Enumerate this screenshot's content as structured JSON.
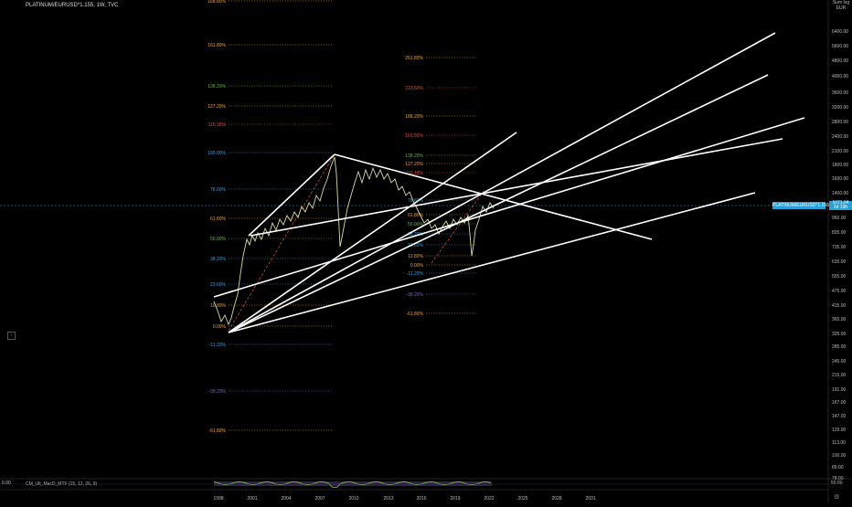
{
  "header": {
    "symbol_title": "PLATINUM/EURUSD*1.155, 1W, TVC",
    "axis_unit_top": "Sum lng",
    "axis_unit_bottom": "EUR"
  },
  "colors": {
    "background": "#000000",
    "price": "#d9d9a0",
    "channel": "#ffffff",
    "fib_orange": "#f0a030",
    "fib_green": "#6ab04c",
    "fib_red": "#e05040",
    "fib_blue": "#3aa0e0",
    "fib_purple": "#8060c0",
    "fib_gray": "#8a8a8a",
    "accent": "#2a9fd6"
  },
  "price_axis": {
    "labels": [
      "6400.00",
      "5600.00",
      "4800.00",
      "4000.00",
      "3600.00",
      "3200.00",
      "2800.00",
      "2400.00",
      "2100.00",
      "1800.00",
      "1600.00",
      "1400.00",
      "1240.00",
      "960.00",
      "835.00",
      "735.00",
      "635.00",
      "555.00",
      "475.00",
      "415.00",
      "365.00",
      "325.00",
      "285.00",
      "245.00",
      "215.00",
      "191.00",
      "167.00",
      "147.00",
      "129.00",
      "113.00",
      "100.00",
      "89.00",
      "78.00"
    ],
    "current_symbol": "PLATINUM/EURUSD*1.155",
    "current_price": "1071.04",
    "current_time": "2d 19h"
  },
  "time_axis": {
    "labels": [
      "1998",
      "2001",
      "2004",
      "2007",
      "2010",
      "2013",
      "2016",
      "2019",
      "2022",
      "2025",
      "2028",
      "2031"
    ]
  },
  "fib_left": {
    "levels": [
      "161.80%",
      "138.20%",
      "127.20%",
      "116.18%",
      "100.00%",
      "78.60%",
      "61.80%",
      "50.00%",
      "38.20%",
      "23.60%",
      "10.80%",
      "0.00%",
      "-11.20%",
      "-38.20%",
      "-61.80%",
      "168.80%"
    ]
  },
  "fib_right": {
    "levels": [
      "261.80%",
      "223.60%",
      "188.20%",
      "161.80%",
      "138.20%",
      "127.20%",
      "116.18%",
      "78.60%",
      "61.80%",
      "50.00%",
      "38.20%",
      "23.60%",
      "10.80%",
      "0.00%",
      "-11.20%",
      "-38.20%",
      "-61.80%"
    ]
  },
  "oscillator": {
    "label": "CM_Ult_MacD_MTF (15, 12, 26, 9)",
    "scale_left": "0.00",
    "scale_right": "50.00",
    "scale_right_value": 50
  }
}
